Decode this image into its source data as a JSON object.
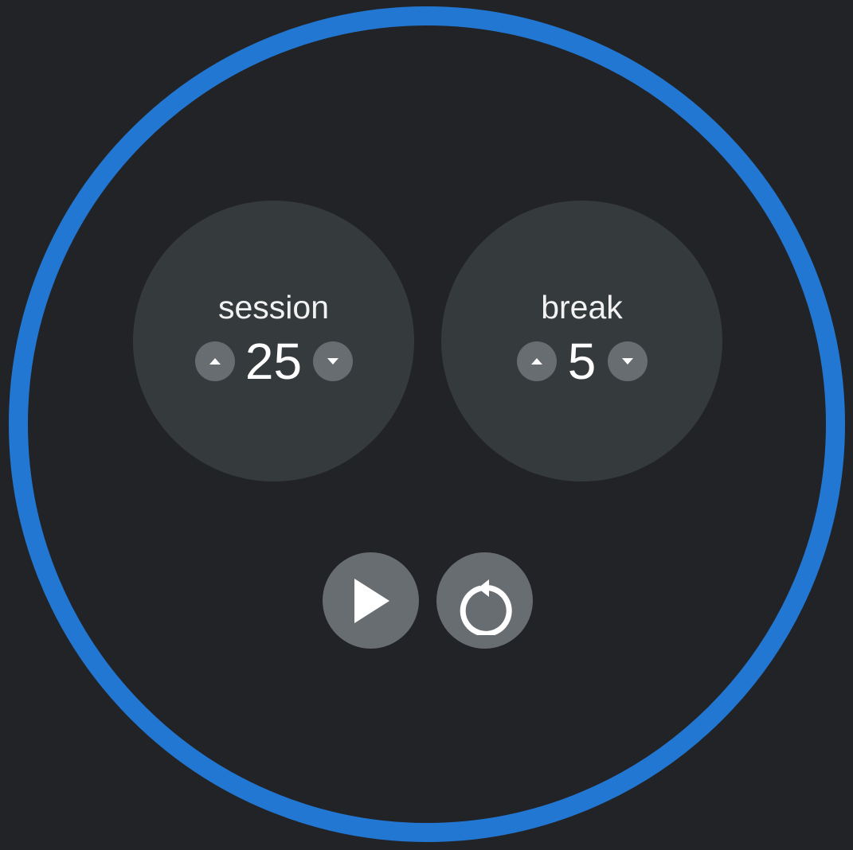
{
  "colors": {
    "background": "#222326",
    "ring": "#2277d3",
    "panel": "#353b3d",
    "button": "#686d71",
    "text": "#ffffff"
  },
  "timer": {
    "progress": 1.0
  },
  "session": {
    "label": "session",
    "value": "25",
    "increment_icon": "caret-up-icon",
    "decrement_icon": "caret-down-icon"
  },
  "break": {
    "label": "break",
    "value": "5",
    "increment_icon": "caret-up-icon",
    "decrement_icon": "caret-down-icon"
  },
  "controls": {
    "play_icon": "play-icon",
    "reset_icon": "reset-icon"
  }
}
